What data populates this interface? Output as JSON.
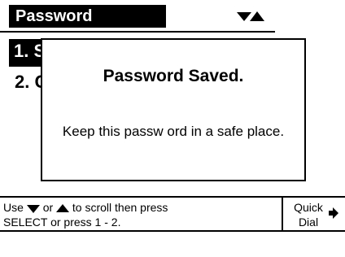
{
  "title_bar": {
    "title": "Password"
  },
  "menu": {
    "items": [
      {
        "label": "1. S",
        "selected": true
      },
      {
        "label": "2. C",
        "selected": false
      }
    ]
  },
  "popup": {
    "title": "Password Saved.",
    "message": "Keep this passw ord in a safe place."
  },
  "help": {
    "use": "Use",
    "or": "or",
    "scroll_then": "to scroll then press",
    "line2": "SELECT or press 1 - 2."
  },
  "softkey": {
    "label_line1": "Quick",
    "label_line2": "Dial"
  }
}
